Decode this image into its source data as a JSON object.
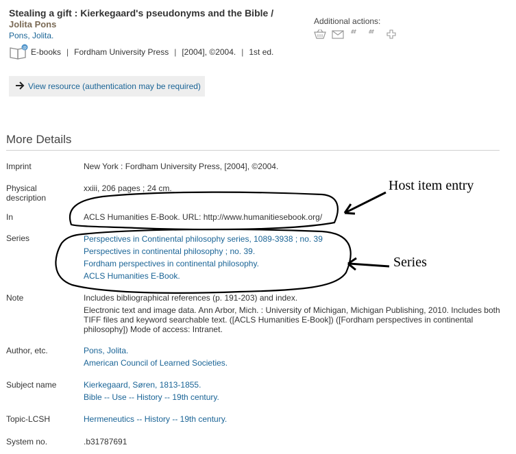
{
  "record": {
    "title": "Stealing a gift : Kierkegaard's pseudonyms and the Bible /",
    "responsibility": "Jolita Pons",
    "author_link": "Pons, Jolita.",
    "format": "E-books",
    "publisher": "Fordham University Press",
    "date": "[2004], ©2004.",
    "edition": "1st ed."
  },
  "additional_actions": {
    "label": "Additional actions:",
    "icons": [
      "basket-icon",
      "email-icon",
      "cite-icon",
      "cite-icon",
      "plus-icon"
    ]
  },
  "view_resource": {
    "label": "View resource (authentication may be required)"
  },
  "more_details": {
    "heading": "More Details",
    "imprint_label": "Imprint",
    "imprint": "New York : Fordham University Press, [2004], ©2004.",
    "physical_label": "Physical description",
    "physical": "xxiii, 206 pages ; 24 cm.",
    "in_label": "In",
    "in": "ACLS Humanities E-Book. URL: http://www.humanitiesebook.org/",
    "series_label": "Series",
    "series": [
      "Perspectives in Continental philosophy series, 1089-3938 ; no. 39",
      "Perspectives in continental philosophy ; no. 39.",
      "Fordham perspectives in continental philosophy.",
      "ACLS Humanities E-Book."
    ],
    "note_label": "Note",
    "note1": "Includes bibliographical references (p. 191-203) and index.",
    "note2": "Electronic text and image data. Ann Arbor, Mich. : University of Michigan, Michigan Publishing, 2010. Includes both TIFF files and keyword searchable text. ([ACLS Humanities E-Book]) ([Fordham perspectives in continental philosophy]) Mode of access: Intranet.",
    "author_label": "Author, etc.",
    "authors": [
      "Pons, Jolita.",
      "American Council of Learned Societies."
    ],
    "subject_label": "Subject name",
    "subjects": [
      "Kierkegaard, Søren, 1813-1855.",
      "Bible -- Use -- History -- 19th century."
    ],
    "topic_label": "Topic-LCSH",
    "topic": "Hermeneutics -- History -- 19th century.",
    "sysno_label": "System no.",
    "sysno": ".b31787691"
  },
  "annotations": {
    "host": "Host item entry",
    "series": "Series"
  }
}
